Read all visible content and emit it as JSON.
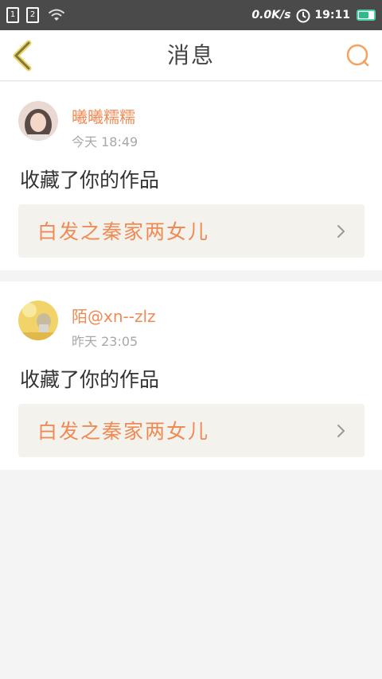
{
  "status_bar": {
    "sim1": "1",
    "sim2": "2",
    "speed": "0.0K/s",
    "time": "19:11"
  },
  "nav": {
    "title": "消息",
    "back_icon": "chevron-left-icon",
    "search_icon": "search-icon"
  },
  "colors": {
    "accent": "#f08a55",
    "back_icon": "#8a8a3a",
    "status_bar": "#4a4a4a"
  },
  "messages": [
    {
      "username": "曦曦糯糯",
      "time": "今天 18:49",
      "action": "收藏了你的作品",
      "work_title": "白发之秦家两女儿"
    },
    {
      "username": "陌@xn--zlz",
      "time": "昨天 23:05",
      "action": "收藏了你的作品",
      "work_title": "白发之秦家两女儿"
    }
  ]
}
